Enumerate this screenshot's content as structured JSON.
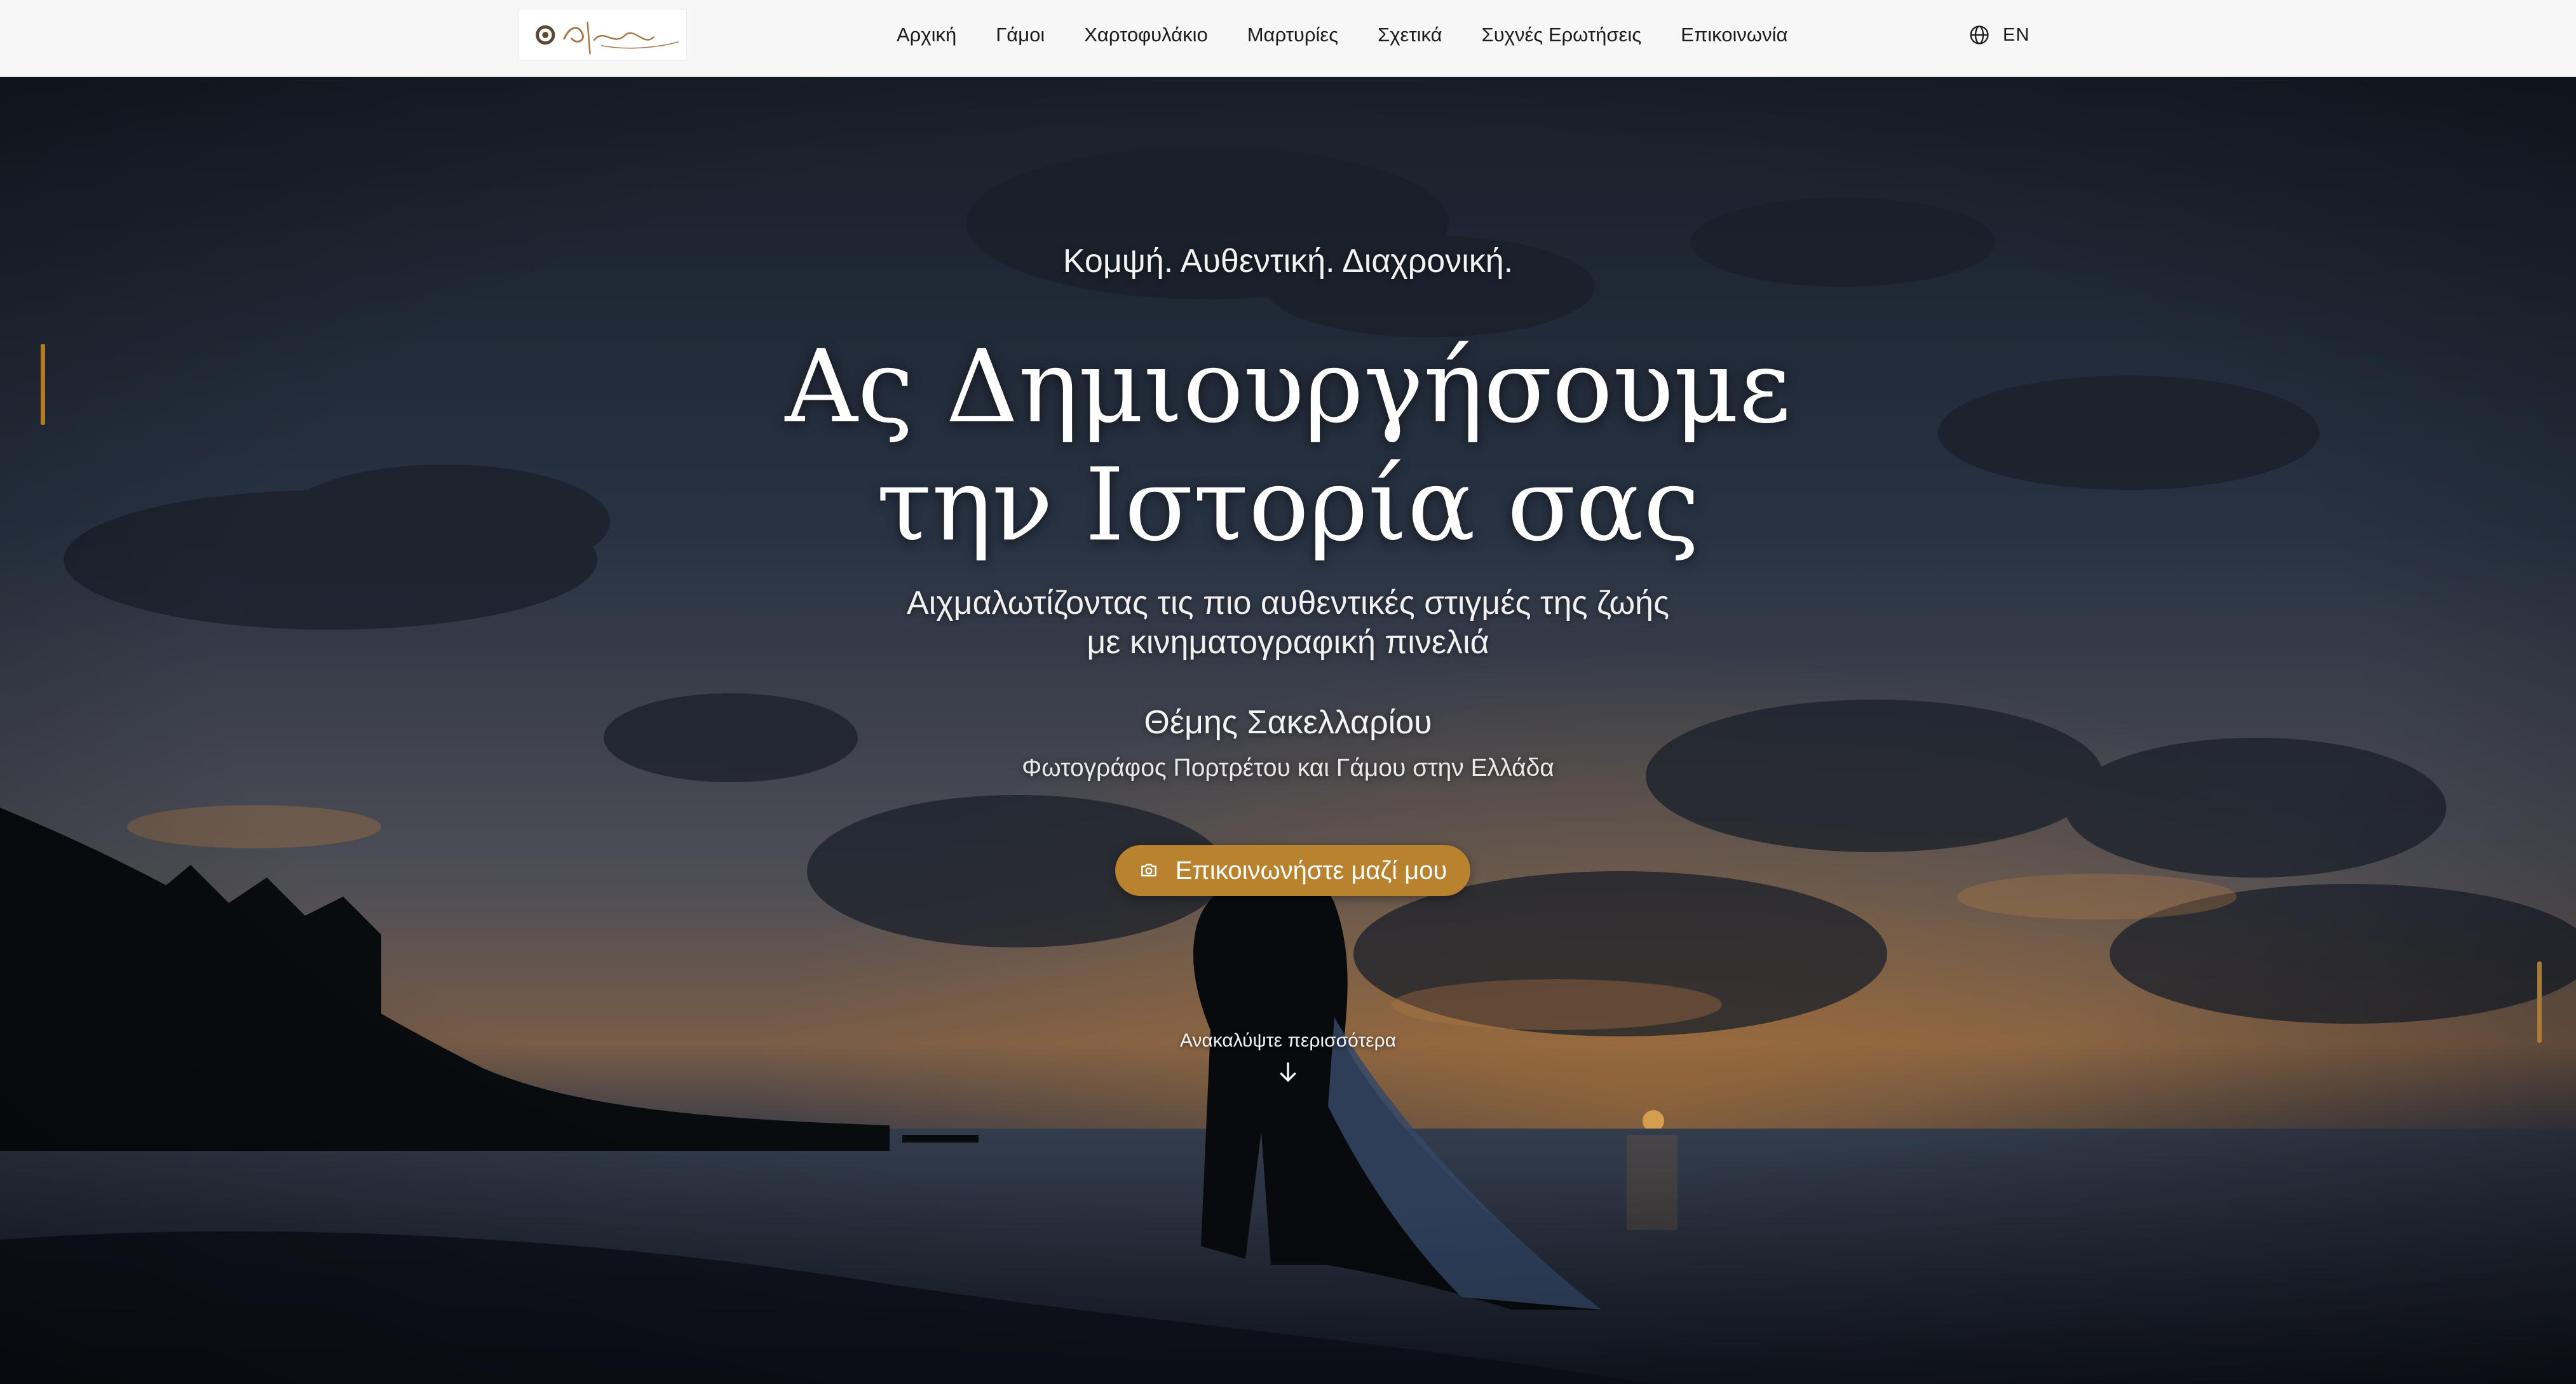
{
  "nav": {
    "logo_text": "Θέμης",
    "links": [
      {
        "label": "Αρχική"
      },
      {
        "label": "Γάμοι"
      },
      {
        "label": "Χαρτοφυλάκιο"
      },
      {
        "label": "Μαρτυρίες"
      },
      {
        "label": "Σχετικά"
      },
      {
        "label": "Συχνές Ερωτήσεις"
      },
      {
        "label": "Επικοινωνία"
      }
    ],
    "language": {
      "label": "EN",
      "icon": "globe-icon"
    }
  },
  "hero": {
    "tagline": "Κομψή. Αυθεντική. Διαχρονική.",
    "headline_line1": "Ας Δημιουργήσουμε",
    "headline_line2": "την Ιστορία σας",
    "subtitle_line1": "Αιχμαλωτίζοντας τις πιο αυθεντικές στιγμές της ζωής",
    "subtitle_line2": "με κινηματογραφική πινελιά",
    "photographer_name": "Θέμης Σακελλαρίου",
    "photographer_role": "Φωτογράφος Πορτρέτου και Γάμου στην Ελλάδα",
    "cta": {
      "label": "Επικοινωνήστε μαζί μου",
      "icon": "camera-icon"
    },
    "discover": {
      "label": "Ανακαλύψτε περισσότερα",
      "icon": "arrow-down-icon"
    }
  },
  "colors": {
    "accent": "#b9822e",
    "nav_bg": "#f7f7f7",
    "nav_text": "#1b1b1b",
    "hero_text": "#ffffff"
  }
}
